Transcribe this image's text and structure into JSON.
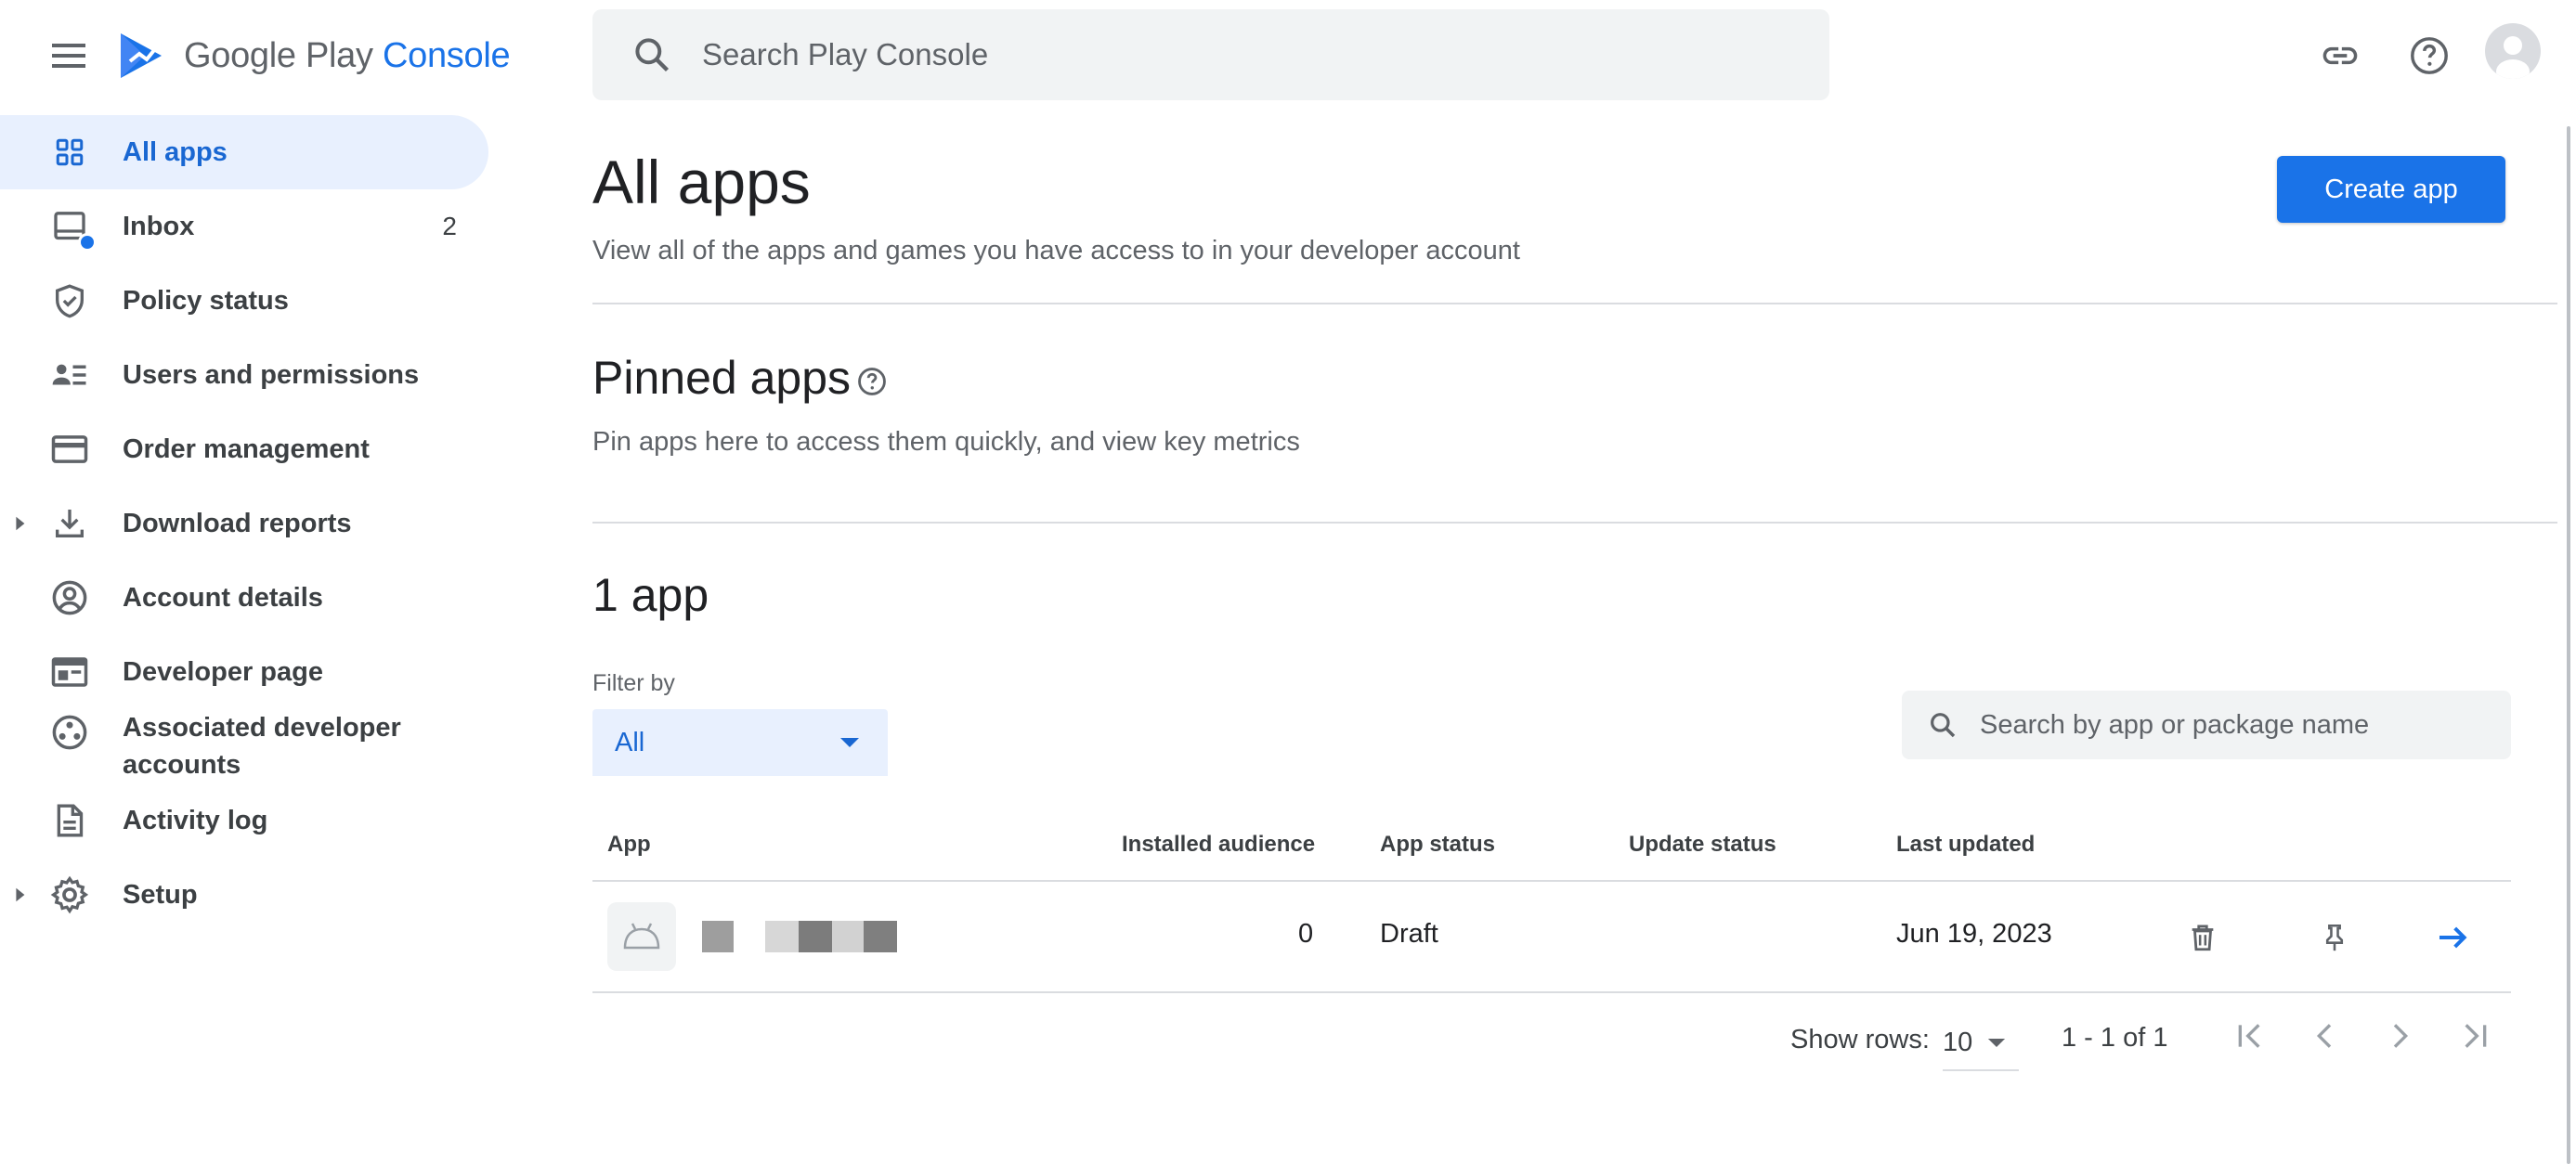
{
  "app": {
    "logo_text_main": "Google Play",
    "logo_text_accent": "Console"
  },
  "header": {
    "search_placeholder": "Search Play Console"
  },
  "sidebar": {
    "items": [
      {
        "label": "All apps",
        "icon": "grid-icon",
        "active": true
      },
      {
        "label": "Inbox",
        "icon": "inbox-icon",
        "count": "2"
      },
      {
        "label": "Policy status",
        "icon": "shield-check-icon"
      },
      {
        "label": "Users and permissions",
        "icon": "people-list-icon"
      },
      {
        "label": "Order management",
        "icon": "credit-card-icon"
      },
      {
        "label": "Download reports",
        "icon": "download-icon",
        "expandable": true
      },
      {
        "label": "Account details",
        "icon": "account-circle-icon"
      },
      {
        "label": "Developer page",
        "icon": "web-page-icon"
      },
      {
        "label": "Associated developer accounts",
        "icon": "linked-accounts-icon"
      },
      {
        "label": "Activity log",
        "icon": "document-icon"
      },
      {
        "label": "Setup",
        "icon": "gear-icon",
        "expandable": true
      }
    ]
  },
  "main": {
    "title": "All apps",
    "subtitle": "View all of the apps and games you have access to in your developer account",
    "create_button": "Create app",
    "pinned": {
      "title": "Pinned apps",
      "subtitle": "Pin apps here to access them quickly, and view key metrics"
    },
    "apps_count": "1 app",
    "filter": {
      "label": "Filter by",
      "value": "All"
    },
    "app_search_placeholder": "Search by app or package name",
    "table": {
      "columns": [
        "App",
        "Installed audience",
        "App status",
        "Update status",
        "Last updated"
      ],
      "rows": [
        {
          "app_name": "",
          "installed_audience": "0",
          "app_status": "Draft",
          "update_status": "",
          "last_updated": "Jun 19, 2023"
        }
      ]
    },
    "pagination": {
      "show_rows_label": "Show rows:",
      "rows_value": "10",
      "range": "1 - 1 of 1"
    }
  },
  "colors": {
    "accent": "#1a73e8",
    "active_bg": "#e8f0fe",
    "surface": "#f1f3f4"
  }
}
